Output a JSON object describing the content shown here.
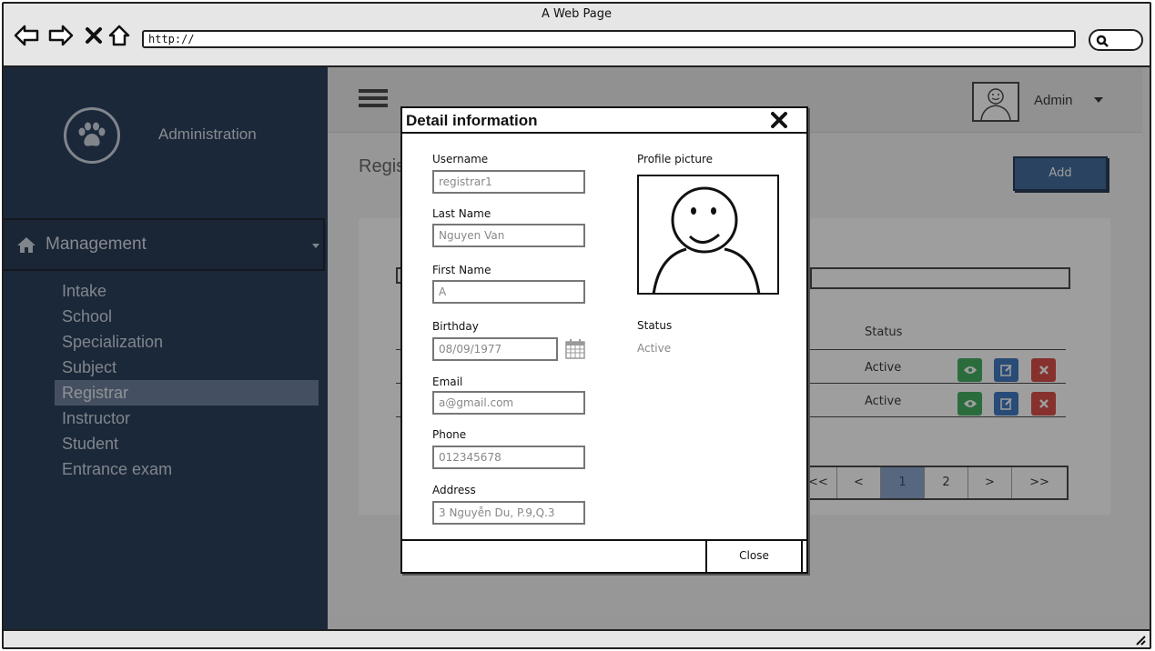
{
  "browser": {
    "window_title": "A Web Page",
    "url": "http://"
  },
  "sidebar": {
    "brand": "Administration",
    "section": "Management",
    "items": [
      {
        "label": "Intake"
      },
      {
        "label": "School"
      },
      {
        "label": "Specialization"
      },
      {
        "label": "Subject"
      },
      {
        "label": "Registrar",
        "active": true
      },
      {
        "label": "Instructor"
      },
      {
        "label": "Student"
      },
      {
        "label": "Entrance exam"
      }
    ]
  },
  "header": {
    "user_name": "Admin"
  },
  "page": {
    "title_partial": "Regis",
    "add_label": "Add",
    "table": {
      "status_header": "Status",
      "rows": [
        {
          "status": "Active"
        },
        {
          "status": "Active"
        }
      ]
    },
    "pagination": [
      "<<",
      "<",
      "1",
      "2",
      ">",
      ">>"
    ],
    "current_page": "1"
  },
  "modal": {
    "title": "Detail information",
    "username_label": "Username",
    "username_value": "registrar1",
    "last_name_label": "Last Name",
    "last_name_value": "Nguyen Van",
    "first_name_label": "First Name",
    "first_name_value": "A",
    "birthday_label": "Birthday",
    "birthday_value": "08/09/1977",
    "email_label": "Email",
    "email_value": "a@gmail.com",
    "phone_label": "Phone",
    "phone_value": "012345678",
    "address_label": "Address",
    "address_value": "3 Nguyễn Du, P.9,Q.3",
    "profile_picture_label": "Profile picture",
    "status_label": "Status",
    "status_value": "Active",
    "close_label": "Close"
  },
  "colors": {
    "sidebar_bg": "#12294a",
    "active_item": "#5c7291",
    "add_button": "#2b5a8f",
    "view_action": "#2ea44f",
    "edit_action": "#2a69b8",
    "delete_action": "#d33a32"
  }
}
